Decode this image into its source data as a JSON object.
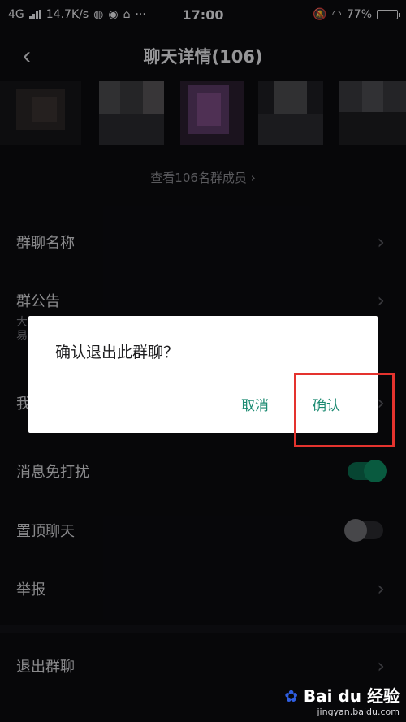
{
  "status_bar": {
    "network": "4G",
    "speed": "14.7K/s",
    "time": "17:00",
    "battery": "77%",
    "battery_level": 0.77,
    "more": "···"
  },
  "header": {
    "title": "聊天详情(106)",
    "back_icon": "back-chevron-icon"
  },
  "members": {
    "link_text": "查看106名群成员 ›"
  },
  "settings": {
    "group_name": {
      "label": "群聊名称"
    },
    "announcement": {
      "label": "群公告",
      "preview_a": "大",
      "preview_b": "易"
    },
    "my_nickname": {
      "label": "我"
    },
    "mute": {
      "label": "消息免打扰",
      "on": true
    },
    "pin": {
      "label": "置顶聊天",
      "on": false
    },
    "report": {
      "label": "举报"
    },
    "leave": {
      "label": "退出群聊"
    }
  },
  "dialog": {
    "title": "确认退出此群聊？",
    "cancel_label": "取消",
    "confirm_label": "确认"
  },
  "watermark": {
    "logo": "Bai du 经验",
    "site": "jingyan.baidu.com"
  },
  "colors": {
    "accent": "#1b8a71",
    "highlight": "#e4332e",
    "background": "#0b0b0f"
  }
}
